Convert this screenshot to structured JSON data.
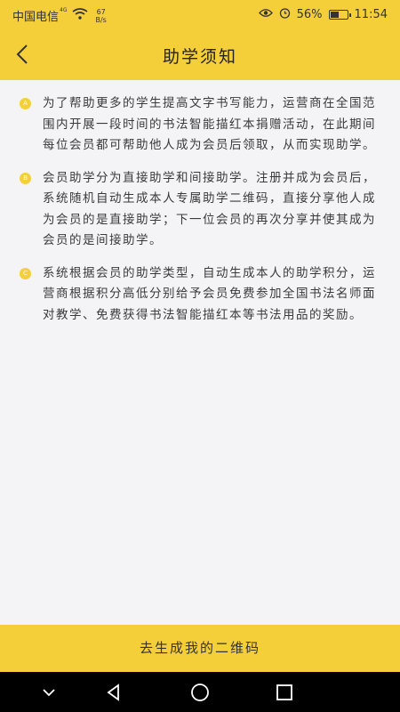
{
  "status_bar": {
    "carrier": "中国电信",
    "network_type": "4G",
    "net_speed_value": "67",
    "net_speed_unit": "B/s",
    "battery_percent": "56%",
    "battery_level": 0.56,
    "time": "11:54"
  },
  "header": {
    "back_icon": "chevron-left-icon",
    "title": "助学须知"
  },
  "notice": {
    "items": [
      {
        "marker": "A",
        "text": "为了帮助更多的学生提高文字书写能力，运营商在全国范围内开展一段时间的书法智能描红本捐赠活动，在此期间每位会员都可帮助他人成为会员后领取，从而实现助学。"
      },
      {
        "marker": "B",
        "text": "会员助学分为直接助学和间接助学。注册并成为会员后，系统随机自动生成本人专属助学二维码，直接分享他人成为会员的是直接助学；下一位会员的再次分享并使其成为会员的是间接助学。"
      },
      {
        "marker": "C",
        "text": "系统根据会员的助学类型，自动生成本人的助学积分，运营商根据积分高低分别给予会员免费参加全国书法名师面对教学、免费获得书法智能描红本等书法用品的奖励。"
      }
    ]
  },
  "footer": {
    "generate_qr_label": "去生成我的二维码"
  },
  "system_nav": {
    "icons": [
      "chevron-down-icon",
      "back-triangle-icon",
      "home-circle-icon",
      "recents-square-icon"
    ]
  },
  "colors": {
    "accent": "#f5cf3a",
    "background": "#f4f3f6",
    "text": "#3a3a3a"
  }
}
